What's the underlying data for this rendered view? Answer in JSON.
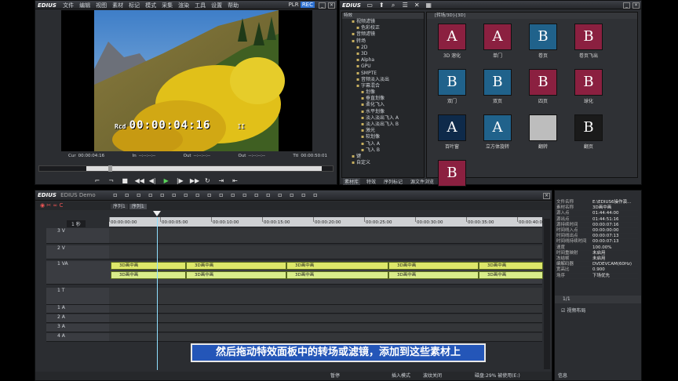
{
  "player": {
    "app": "EDIUS",
    "menu": [
      "文件",
      "编辑",
      "视图",
      "素材",
      "标记",
      "模式",
      "采集",
      "渲染",
      "工具",
      "设置",
      "帮助"
    ],
    "mode_plr": "PLR",
    "mode_rec": "REC",
    "timecode_label": "Rcd",
    "timecode": "00:00:04:16",
    "pause_glyph": "II",
    "info": [
      {
        "label": "Cur",
        "value": "00:00:04:16"
      },
      {
        "label": "In",
        "value": "--:--:--:--"
      },
      {
        "label": "Out",
        "value": "--:--:--:--"
      },
      {
        "label": "Out",
        "value": "--:--:--:--"
      },
      {
        "label": "Ttl",
        "value": "00:00:50:01"
      }
    ]
  },
  "effects": {
    "app": "EDIUS",
    "panel_title": "特效",
    "path": "[转场/3D]-[3D]",
    "tree": [
      "视频滤镜",
      "色彩校正",
      "音频滤镜",
      "转场",
      "2D",
      "3D",
      "Alpha",
      "GPU",
      "SMPTE",
      "音频淡入淡出",
      "字幕混合",
      "划像",
      "垂直划像",
      "柔化飞入",
      "水平划像",
      "淡入淡出飞入 A",
      "淡入淡出飞入 B",
      "激光",
      "软划像",
      "飞入 A",
      "飞入 B",
      "键",
      "自定义"
    ],
    "thumbs": [
      {
        "letter": "A",
        "label": "3D 溶化",
        "bg": "#8b2040"
      },
      {
        "letter": "A",
        "label": "单门",
        "bg": "#8b2040"
      },
      {
        "letter": "B",
        "label": "卷页",
        "bg": "#20628b"
      },
      {
        "letter": "B",
        "label": "卷页飞出",
        "bg": "#8b2040"
      },
      {
        "letter": "B",
        "label": "双门",
        "bg": "#20628b"
      },
      {
        "letter": "B",
        "label": "双页",
        "bg": "#20628b"
      },
      {
        "letter": "B",
        "label": "四页",
        "bg": "#8b2040"
      },
      {
        "letter": "B",
        "label": "球化",
        "bg": "#8b2040"
      },
      {
        "letter": "A",
        "label": "百叶窗",
        "bg": "#0e2a4a"
      },
      {
        "letter": "A",
        "label": "立方体旋转",
        "bg": "#20628b"
      },
      {
        "letter": "",
        "label": "翻转",
        "bg": "#bdbdbd"
      },
      {
        "letter": "B",
        "label": "翻页",
        "bg": "#1a1a1a"
      },
      {
        "letter": "B",
        "label": "",
        "bg": "#8b2040"
      }
    ],
    "tabs": [
      "素材库",
      "特效",
      "序列标记",
      "源文件浏览"
    ]
  },
  "timeline": {
    "app": "EDIUS",
    "project": "EDIUS Demo",
    "seq_tabs": [
      "序列1",
      "序列1"
    ],
    "zoom": "1 秒",
    "ruler": [
      "00:00:00:00",
      "00:00:05:00",
      "00:00:10:00",
      "00:00:15:00",
      "00:00:20:00",
      "00:00:25:00",
      "00:00:30:00",
      "00:00:35:00",
      "00:00:40:00"
    ],
    "tracks": [
      "3 V",
      "2 V",
      "1 VA",
      "1 T",
      "1 A",
      "2 A",
      "3 A",
      "4 A"
    ],
    "clip_name": "3D画中画",
    "status": [
      "暂停",
      "插入模式",
      "波纹关闭",
      "磁盘:29% 被使用(E:)"
    ]
  },
  "info_panel": {
    "rows": [
      {
        "k": "文件名称",
        "v": "E:\\EDIUS6操作演..."
      },
      {
        "k": "素材名称",
        "v": "3D画中画"
      },
      {
        "k": "源入点",
        "v": "01:44:44:00"
      },
      {
        "k": "源出点",
        "v": "01:44:51:16"
      },
      {
        "k": "源持续时间",
        "v": "00:00:07:16"
      },
      {
        "k": "时间线入点",
        "v": "00:00:00:00"
      },
      {
        "k": "时间线出点",
        "v": "00:00:07:13"
      },
      {
        "k": "时间线持续时间",
        "v": "00:00:07:13"
      },
      {
        "k": "速度",
        "v": "100.00%"
      },
      {
        "k": "时间重映射",
        "v": "未启用"
      },
      {
        "k": "冻结帧",
        "v": "未启用"
      },
      {
        "k": "编解码器",
        "v": "DVDEVCAM(60Hz)"
      },
      {
        "k": "宽高比",
        "v": "0.900"
      },
      {
        "k": "场序",
        "v": "下场优先"
      }
    ],
    "page": "1/1",
    "filter_label": "视频布局",
    "tab": "信息"
  },
  "subtitle": "然后拖动特效面板中的转场或滤镜，添加到这些素材上"
}
